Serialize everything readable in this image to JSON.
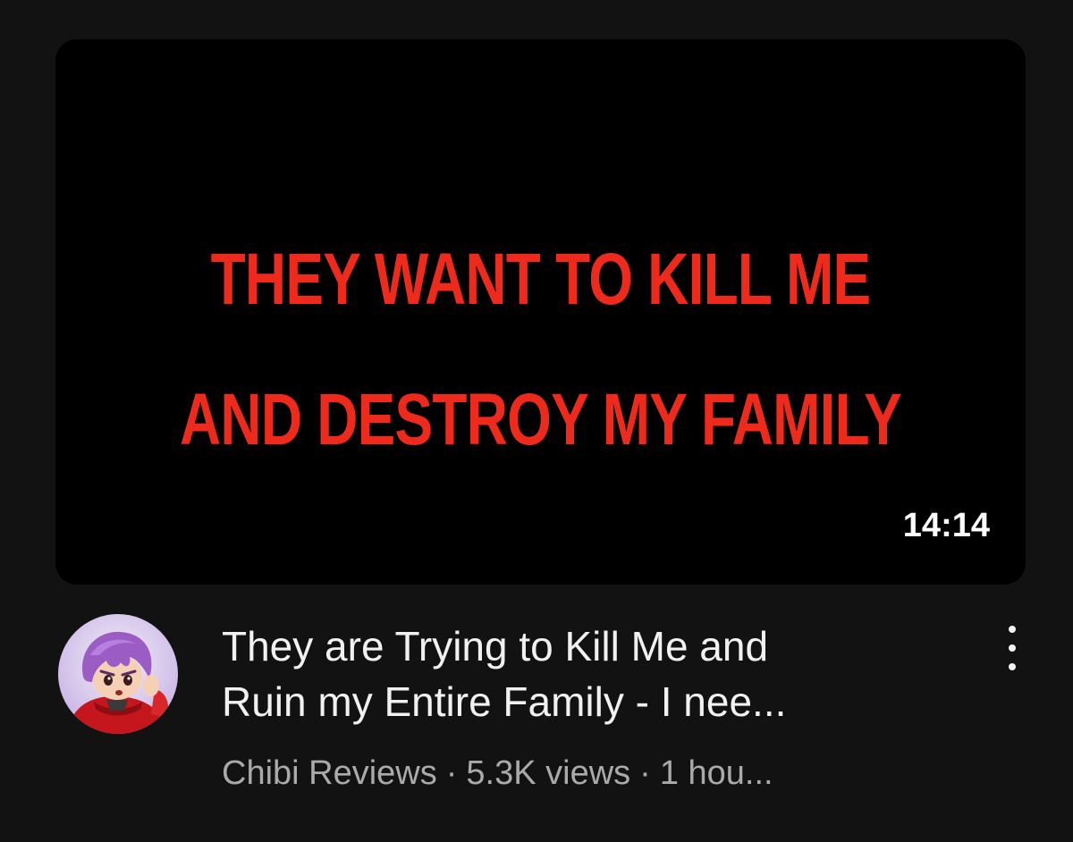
{
  "thumbnail": {
    "line1": "THEY WANT TO KILL ME",
    "line2": "AND DESTROY MY FAMILY",
    "text_color": "#ee2a1c",
    "background": "#000000"
  },
  "duration": "14:14",
  "video": {
    "title_line1": "They are Trying to Kill Me and",
    "title_line2": "Ruin my Entire Family - I nee..."
  },
  "channel": {
    "name": "Chibi Reviews",
    "avatar_icon": "channel-avatar-icon"
  },
  "stats": {
    "views": "5.3K views",
    "age": "1 hou...",
    "separator": "·"
  },
  "menu_icon": "more-vertical-icon",
  "colors": {
    "page_background": "#121212",
    "title_text": "#f1f1f1",
    "meta_text": "#aaaaaa"
  }
}
